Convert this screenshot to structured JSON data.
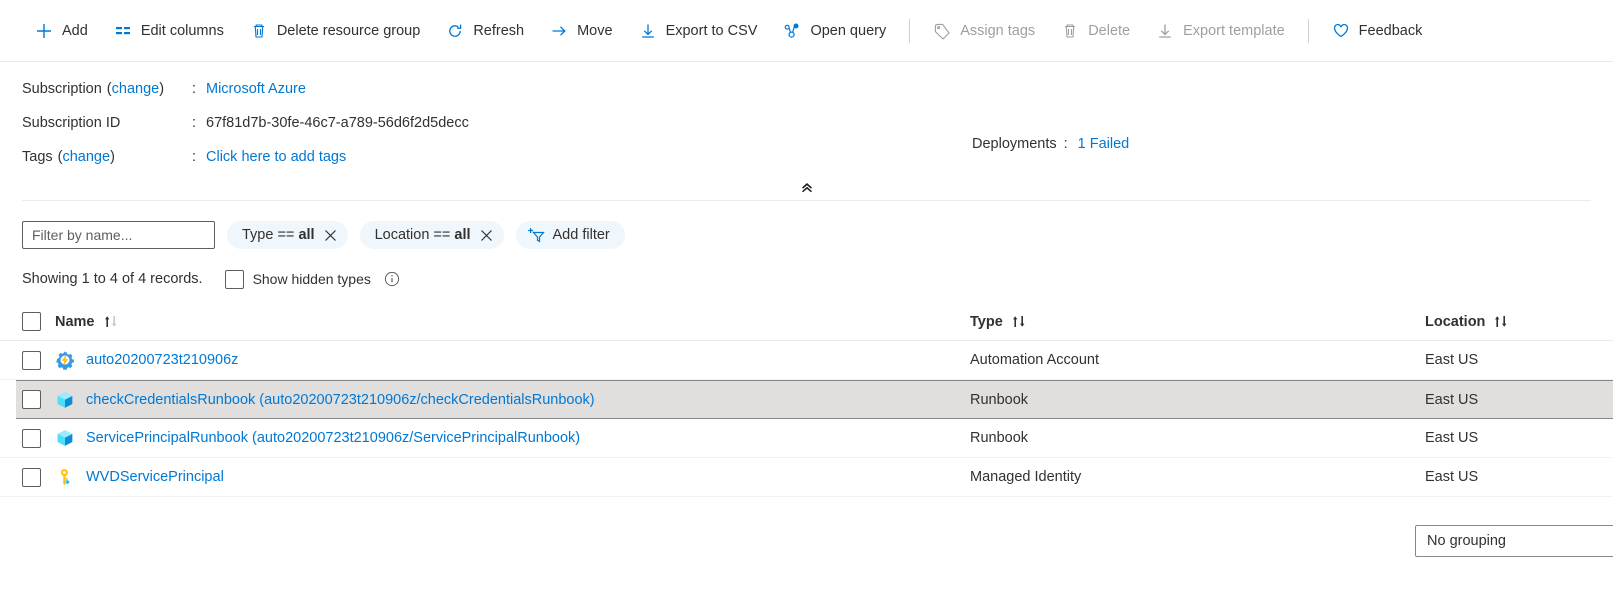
{
  "toolbar": {
    "items": [
      {
        "label": "Add",
        "icon": "plus-icon",
        "disabled": false
      },
      {
        "label": "Edit columns",
        "icon": "edit-columns-icon",
        "disabled": false
      },
      {
        "label": "Delete resource group",
        "icon": "trash-icon",
        "disabled": false
      },
      {
        "label": "Refresh",
        "icon": "refresh-icon",
        "disabled": false
      },
      {
        "label": "Move",
        "icon": "arrow-right-icon",
        "disabled": false
      },
      {
        "label": "Export to CSV",
        "icon": "download-icon",
        "disabled": false
      },
      {
        "label": "Open query",
        "icon": "open-query-icon",
        "disabled": false
      },
      {
        "label": "Assign tags",
        "icon": "tag-icon",
        "disabled": true
      },
      {
        "label": "Delete",
        "icon": "trash-icon",
        "disabled": true
      },
      {
        "label": "Export template",
        "icon": "download-icon",
        "disabled": true
      },
      {
        "label": "Feedback",
        "icon": "heart-icon",
        "disabled": false
      }
    ]
  },
  "essentials": {
    "subscription_label": "Subscription",
    "subscription_change": "change",
    "subscription_value": "Microsoft Azure",
    "subscription_id_label": "Subscription ID",
    "subscription_id_value": "67f81d7b-30fe-46c7-a789-56d6f2d5decc",
    "tags_label": "Tags",
    "tags_change": "change",
    "tags_value": "Click here to add tags",
    "deployments_label": "Deployments",
    "deployments_value": "1 Failed",
    "colon": ":",
    "paren_open": "(",
    "paren_close": ")"
  },
  "filters": {
    "name_placeholder": "Filter by name...",
    "name_value": "",
    "pills": [
      {
        "field": "Type",
        "op": "==",
        "value": "all"
      },
      {
        "field": "Location",
        "op": "==",
        "value": "all"
      }
    ],
    "add_filter_label": "Add filter"
  },
  "records": {
    "showing_text": "Showing 1 to 4 of 4 records.",
    "show_hidden_label": "Show hidden types",
    "show_hidden_checked": false,
    "grouping_value": "No grouping"
  },
  "table": {
    "columns": [
      {
        "label": "Name",
        "sortable": true
      },
      {
        "label": "Type",
        "sortable": true
      },
      {
        "label": "Location",
        "sortable": true
      }
    ],
    "rows": [
      {
        "name": "auto20200723t210906z",
        "type": "Automation Account",
        "location": "East US",
        "icon": "automation-account-icon",
        "selected": false,
        "checked": false
      },
      {
        "name": "checkCredentialsRunbook (auto20200723t210906z/checkCredentialsRunbook)",
        "type": "Runbook",
        "location": "East US",
        "icon": "runbook-icon",
        "selected": true,
        "checked": false
      },
      {
        "name": "ServicePrincipalRunbook (auto20200723t210906z/ServicePrincipalRunbook)",
        "type": "Runbook",
        "location": "East US",
        "icon": "runbook-icon",
        "selected": false,
        "checked": false
      },
      {
        "name": "WVDServicePrincipal",
        "type": "Managed Identity",
        "location": "East US",
        "icon": "managed-identity-key-icon",
        "selected": false,
        "checked": false
      }
    ]
  },
  "colors": {
    "accent": "#0078d4",
    "link": "#0078d4",
    "selected_row": "#e1dfdd",
    "pill_bg": "#eff6fc",
    "disabled_text": "#a19f9d"
  }
}
